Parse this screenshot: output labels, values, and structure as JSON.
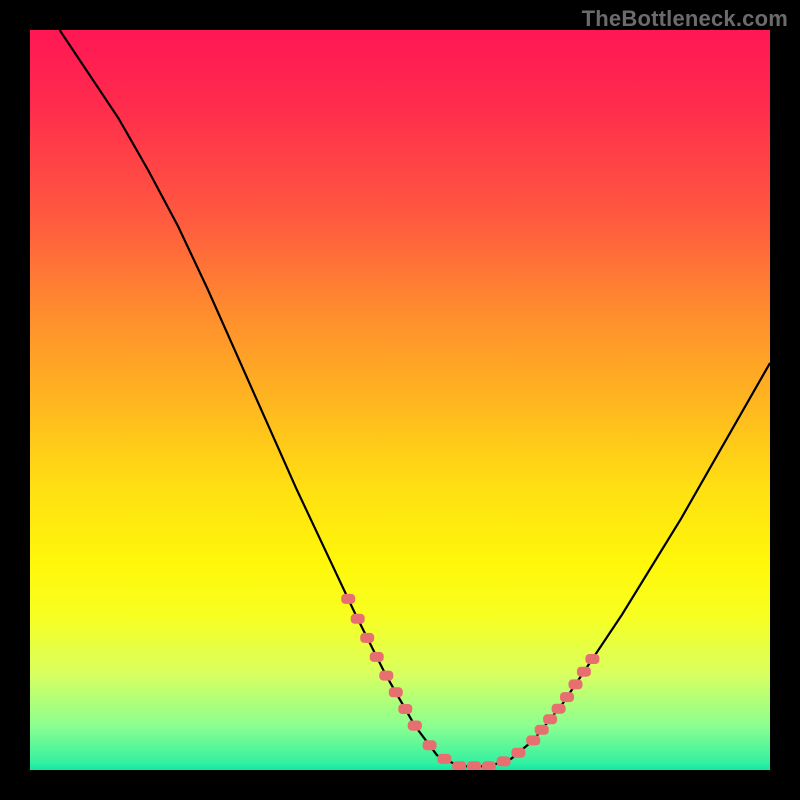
{
  "watermark": "TheBottleneck.com",
  "chart_data": {
    "type": "line",
    "title": "",
    "xlabel": "",
    "ylabel": "",
    "xlim": [
      0,
      100
    ],
    "ylim": [
      0,
      100
    ],
    "series": [
      {
        "name": "bottleneck-curve",
        "x": [
          4,
          8,
          12,
          16,
          20,
          24,
          28,
          32,
          36,
          40,
          44,
          48,
          52,
          55,
          58,
          62,
          65,
          68,
          72,
          76,
          80,
          84,
          88,
          92,
          96,
          100
        ],
        "y": [
          100,
          94,
          88,
          81,
          73.5,
          65,
          56,
          47,
          38,
          29.5,
          21,
          13,
          6,
          2,
          0.5,
          0.5,
          1.5,
          4,
          9,
          15,
          21,
          27.5,
          34,
          41,
          48,
          55
        ]
      }
    ],
    "markers": [
      {
        "name": "highlight-cluster-left",
        "x_range": [
          43,
          52
        ],
        "y_range": [
          2,
          22
        ],
        "color": "#e76f6f"
      },
      {
        "name": "highlight-cluster-bottom",
        "x_range": [
          52,
          66
        ],
        "y_range": [
          0,
          3
        ],
        "color": "#e76f6f"
      },
      {
        "name": "highlight-cluster-right",
        "x_range": [
          68,
          76
        ],
        "y_range": [
          5,
          22
        ],
        "color": "#e76f6f"
      }
    ],
    "gradient_stops": [
      {
        "pos": 0,
        "color": "#ff1754"
      },
      {
        "pos": 50,
        "color": "#ffe012"
      },
      {
        "pos": 100,
        "color": "#10e8a8"
      }
    ]
  }
}
